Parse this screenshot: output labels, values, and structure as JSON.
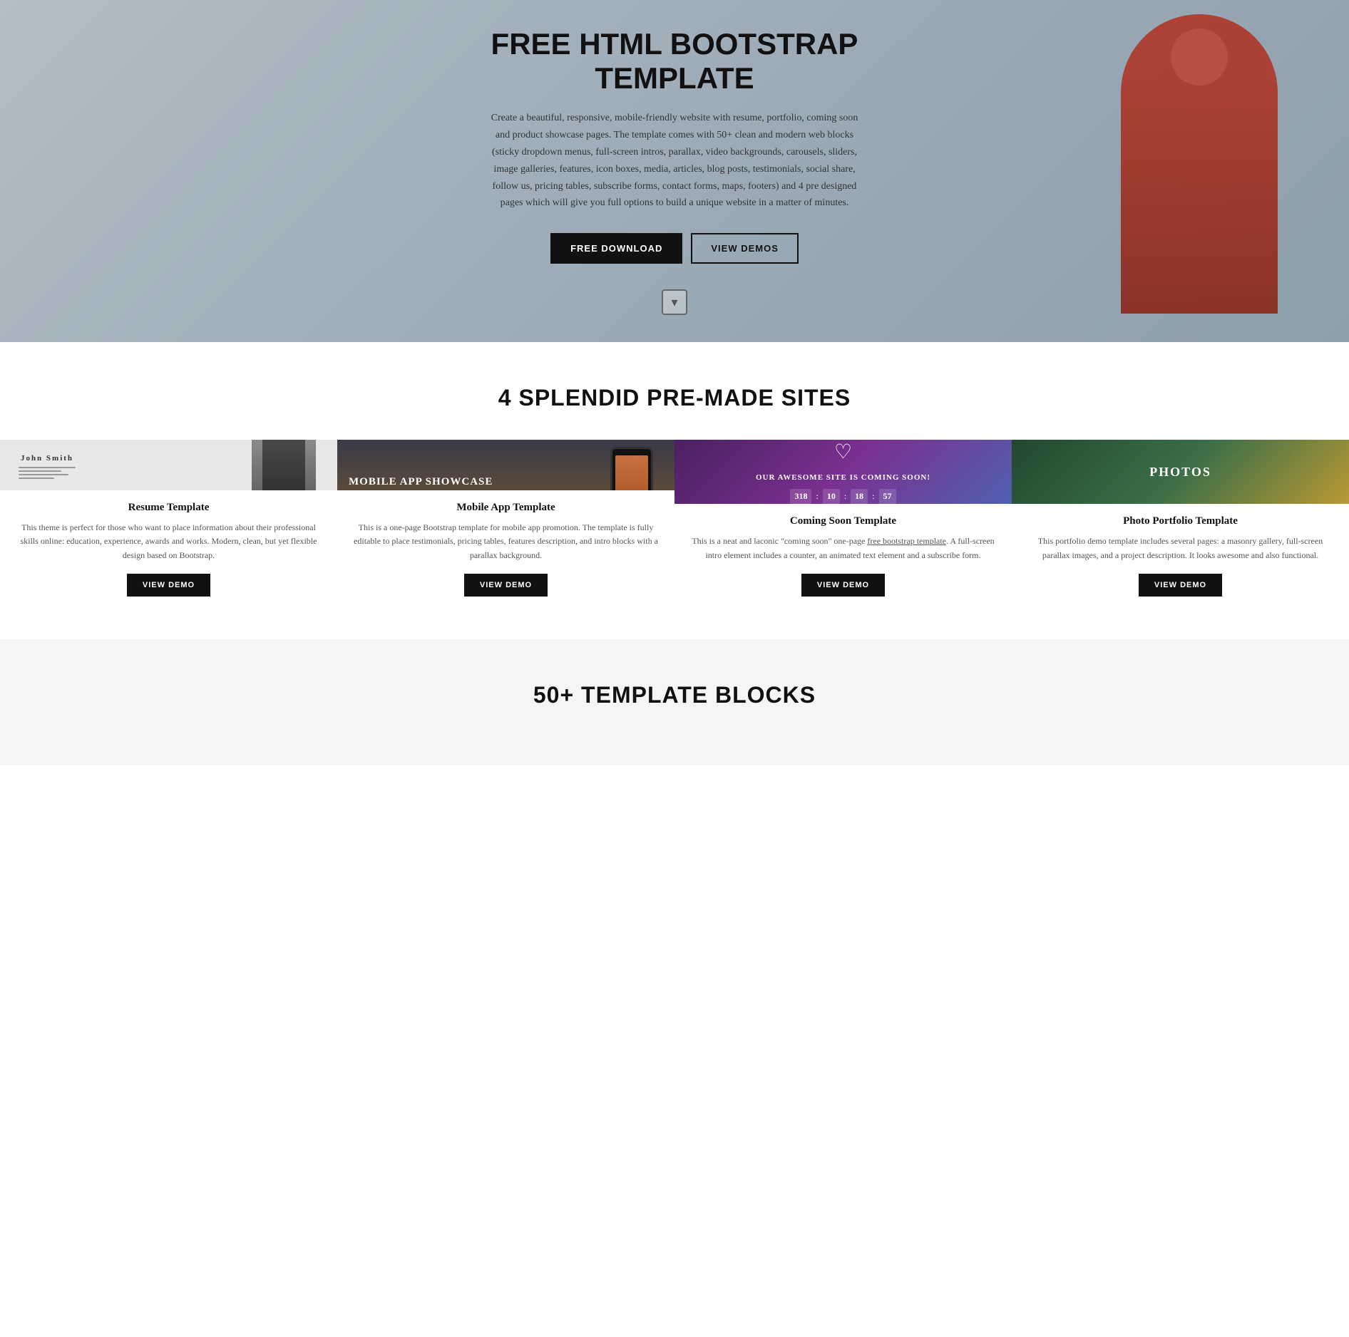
{
  "hero": {
    "title": "FREE HTML BOOTSTRAP TEMPLATE",
    "description": "Create a beautiful, responsive, mobile-friendly website with resume, portfolio, coming soon and product showcase pages. The template comes with 50+ clean and modern web blocks (sticky dropdown menus, full-screen intros, parallax, video backgrounds, carousels, sliders, image galleries, features, icon boxes, media, articles, blog posts, testimonials, social share, follow us, pricing tables, subscribe forms, contact forms, maps, footers) and 4 pre designed pages which will give you full options to build a unique website in a matter of minutes.",
    "btn_download": "FREE DOWNLOAD",
    "btn_demos": "VIEW DEMOS"
  },
  "premade": {
    "section_title": "4 SPLENDID PRE-MADE SITES",
    "cards": [
      {
        "name": "Resume Template",
        "desc": "This theme is perfect for those who want to place information about their professional skills online: education, experience, awards and works. Modern, clean, but yet flexible design based on Bootstrap.",
        "btn": "VIEW DEMO",
        "thumb_name": "John Smith",
        "thumb_lines": [
          3,
          2,
          4
        ]
      },
      {
        "name": "Mobile App Template",
        "desc": "This is a one-page Bootstrap template for mobile app promotion. The template is fully editable to place testimonials, pricing tables, features description, and intro blocks with a parallax background.",
        "btn": "VIEW DEMO",
        "thumb_title": "MOBILE APP SHOWCASE"
      },
      {
        "name": "Coming Soon Template",
        "desc": "This is a neat and laconic \"coming soon\" one-page free bootstrap template. A full-screen intro element includes a counter, an animated text element and a subscribe form.",
        "btn": "VIEW DEMO",
        "thumb_text": "OUR AWESOME SITE IS COMING SOON!",
        "counter": [
          "318",
          "10",
          "18",
          "57"
        ]
      },
      {
        "name": "Photo Portfolio Template",
        "desc": "This portfolio demo template includes several pages: a masonry gallery, full-screen parallax images, and a project description. It looks awesome and also functional.",
        "btn": "VIEW DEMO",
        "thumb_label": "PHOTOS"
      }
    ]
  },
  "blocks_section": {
    "title": "50+ TEMPLATE BLOCKS"
  }
}
